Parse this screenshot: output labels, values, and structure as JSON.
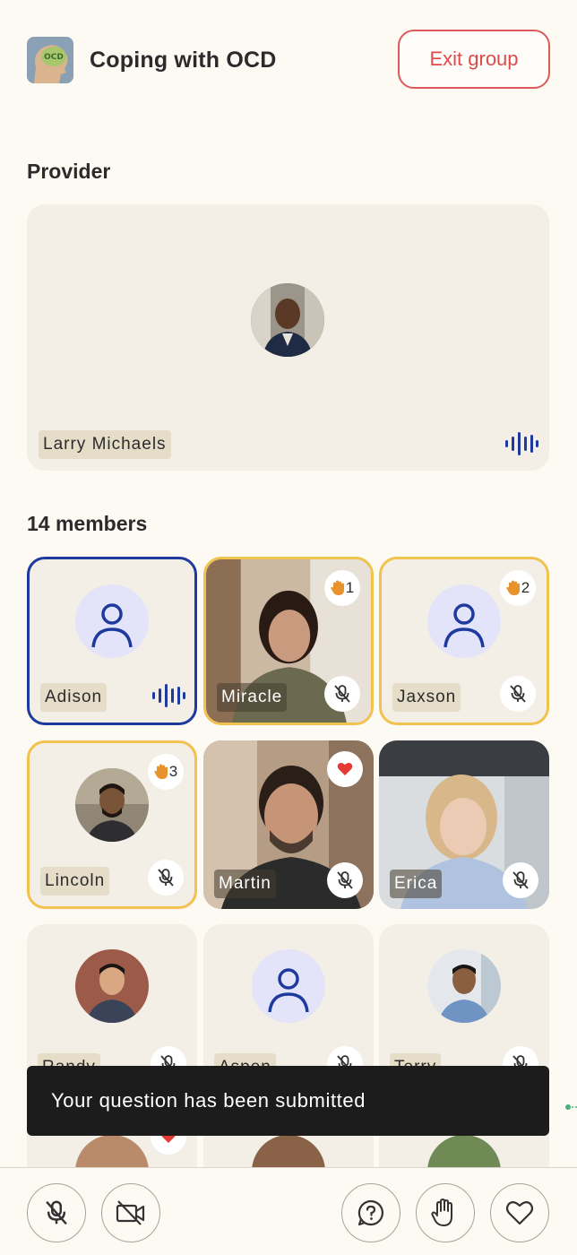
{
  "header": {
    "group_logo_icon": "brain-ocd-logo",
    "title": "Coping with OCD",
    "exit_label": "Exit group"
  },
  "provider": {
    "section_title": "Provider",
    "name": "Larry Michaels",
    "speaking": true
  },
  "members": {
    "section_title": "14 members",
    "tiles": [
      {
        "name": "Adison",
        "state": "speaking",
        "avatar": "generic"
      },
      {
        "name": "Miracle",
        "state": "hand",
        "hand_count": "1",
        "muted": true,
        "avatar": "photo"
      },
      {
        "name": "Jaxson",
        "state": "hand",
        "hand_count": "2",
        "muted": true,
        "avatar": "generic"
      },
      {
        "name": "Lincoln",
        "state": "hand",
        "hand_count": "3",
        "muted": true,
        "avatar": "photo-circle"
      },
      {
        "name": "Martin",
        "reaction": "heart",
        "muted": true,
        "avatar": "photo"
      },
      {
        "name": "Erica",
        "muted": true,
        "avatar": "photo"
      },
      {
        "name": "Randy",
        "muted": true,
        "avatar": "photo-circle"
      },
      {
        "name": "Aspen",
        "muted": true,
        "avatar": "generic"
      },
      {
        "name": "Terry",
        "muted": true,
        "avatar": "photo-circle"
      }
    ]
  },
  "toast": {
    "message": "Your question has been submitted"
  },
  "toolbar": {
    "buttons": [
      "mic-off-icon",
      "camera-off-icon",
      "question-icon",
      "raise-hand-icon",
      "heart-icon"
    ]
  },
  "colors": {
    "background": "#FDFAF4",
    "tile": "#F3EFE6",
    "accent_blue": "#1E3A9E",
    "hand_yellow": "#F2C24F",
    "exit_red": "#DD5A5A",
    "toast": "#1C1C1C"
  }
}
